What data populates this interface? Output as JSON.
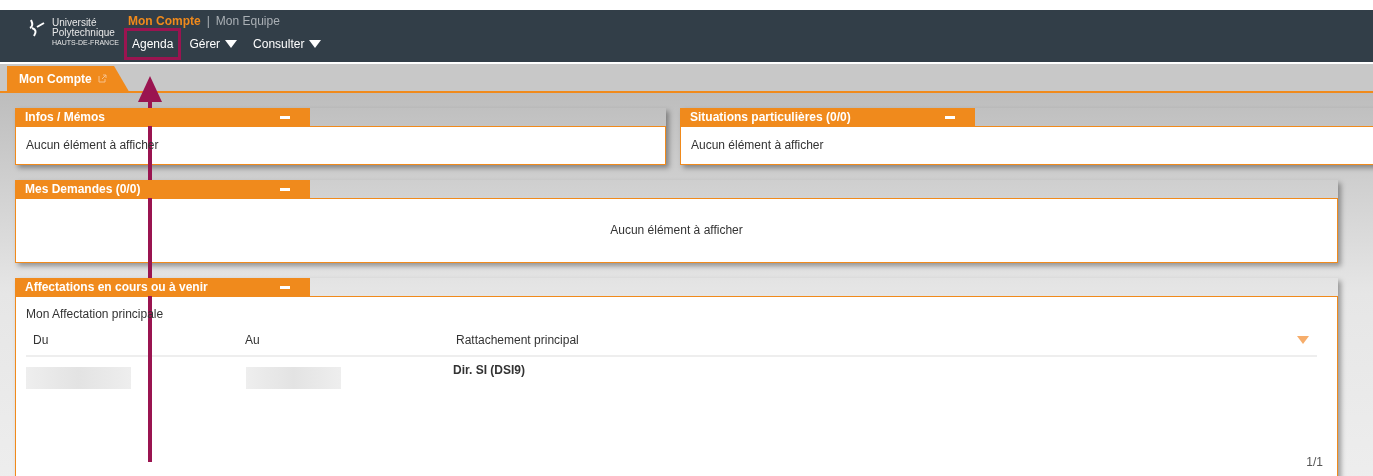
{
  "logo": {
    "lines": [
      "Université",
      "Polytechnique",
      "HAUTS-DE-FRANCE"
    ]
  },
  "top_nav": [
    {
      "label": "Mon Compte",
      "selected": true
    },
    {
      "label": "Mon Equipe",
      "selected": false
    }
  ],
  "top_nav_separator": "|",
  "menu": [
    {
      "label": "Agenda",
      "dropdown": false,
      "highlighted": true
    },
    {
      "label": "Gérer",
      "dropdown": true,
      "highlighted": false
    },
    {
      "label": "Consulter",
      "dropdown": true,
      "highlighted": false
    }
  ],
  "tabs": [
    {
      "label": "Mon Compte",
      "selected": true
    }
  ],
  "panel_rows": [
    [
      {
        "title": "Infos / Mémos",
        "kind": "empty",
        "message": "Aucun élément à afficher"
      },
      {
        "title": "Situations particulières (0/0)",
        "kind": "empty",
        "message": "Aucun élément à afficher"
      }
    ],
    [
      {
        "title": "Mes Demandes (0/0)",
        "kind": "empty_center",
        "message": "Aucun élément à afficher"
      }
    ],
    [
      {
        "title": "Affectations en cours ou à venir",
        "kind": "table",
        "subtitle": "Mon Affectation principale",
        "columns": [
          "Du",
          "Au",
          "Rattachement principal"
        ],
        "rows": [
          {
            "cells": [
              {
                "redacted": true
              },
              {
                "redacted": true
              },
              {
                "text": "Dir. SI (DSI9)"
              }
            ]
          }
        ],
        "pager": "1/1"
      }
    ]
  ]
}
